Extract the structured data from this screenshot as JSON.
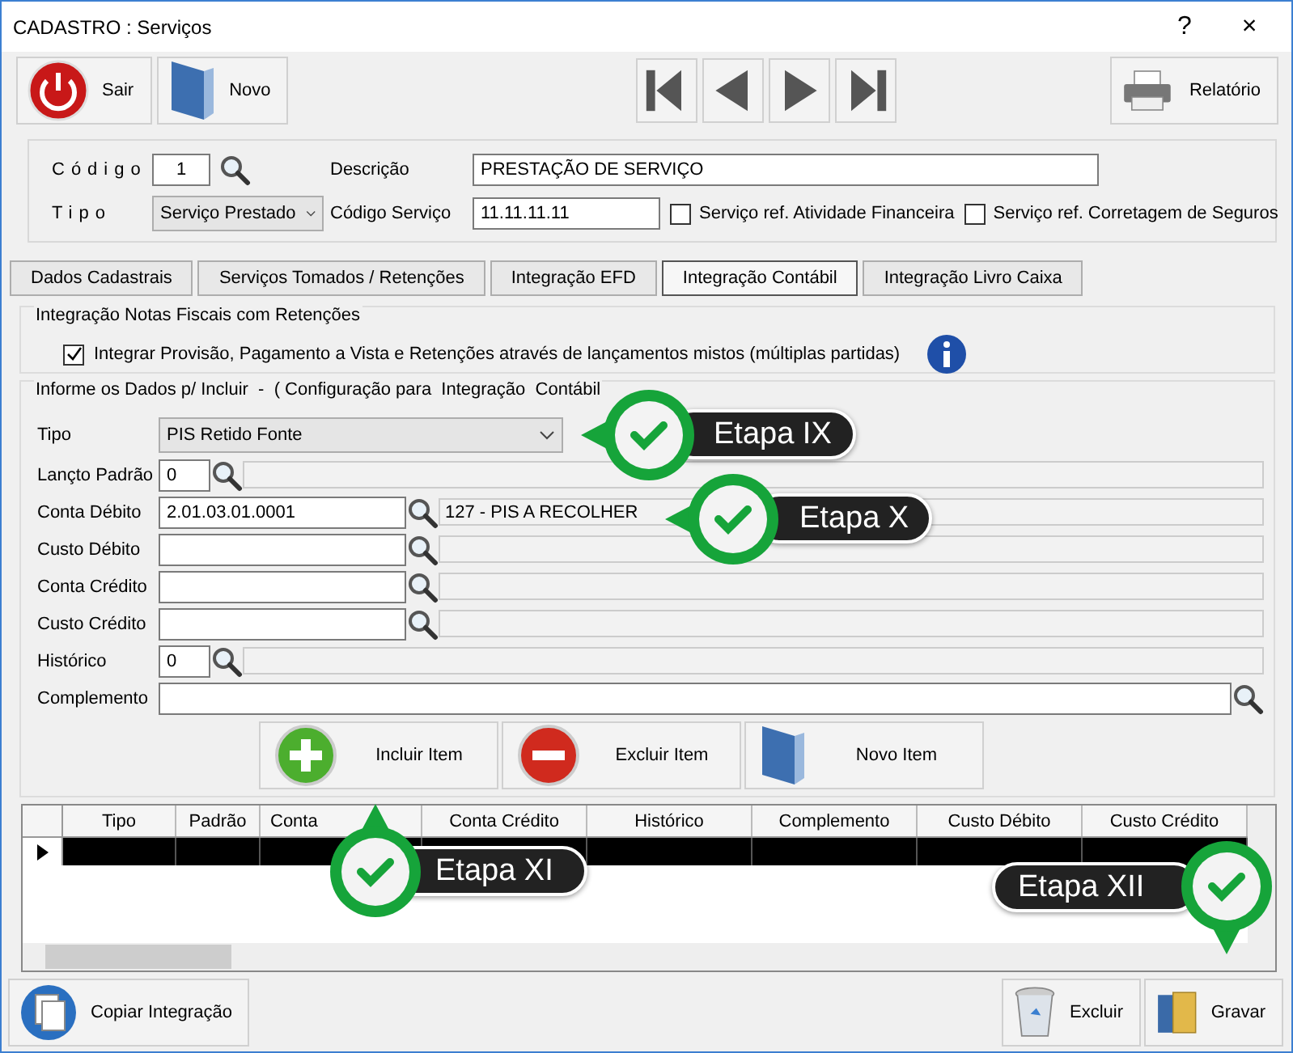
{
  "window": {
    "title": "CADASTRO : Serviços",
    "help": "?",
    "close": "×"
  },
  "toolbar": {
    "left": [
      {
        "label": "Sair",
        "kind": "power"
      },
      {
        "label": "Novo",
        "kind": "book"
      }
    ],
    "nav": [
      {
        "kind": "first"
      },
      {
        "kind": "prev"
      },
      {
        "kind": "next"
      },
      {
        "kind": "last"
      }
    ],
    "right": [
      {
        "label": "Relatório",
        "kind": "printer"
      }
    ]
  },
  "header": {
    "codigo_label": "Código",
    "codigo": "1",
    "descricao_label": "Descrição",
    "descricao": "PRESTAÇÃO DE SERVIÇO",
    "tipo_label": "Tipo",
    "tipo": "Serviço Prestado",
    "codigo_servico_label": "Código Serviço",
    "codigo_servico": "11.11.11.11",
    "checks": [
      {
        "label": "Serviço ref. Atividade Financeira",
        "checked": false
      },
      {
        "label": "Serviço ref. Corretagem de Seguros",
        "checked": false
      }
    ]
  },
  "tabs": [
    {
      "label": "Dados Cadastrais",
      "selected": false
    },
    {
      "label": "Serviços Tomados / Retenções",
      "selected": false
    },
    {
      "label": "Integração EFD",
      "selected": false
    },
    {
      "label": "Integração Contábil",
      "selected": true
    },
    {
      "label": "Integração Livro Caixa",
      "selected": false
    }
  ],
  "notas_group": {
    "title": "Integração Notas Fiscais com Retenções",
    "label": "Integrar Provisão, Pagamento a Vista e Retenções através de lançamentos mistos (múltiplas partidas)",
    "checked": true
  },
  "dados_group": {
    "title": "Informe os Dados p/ Incluir  -  ( Configuração para  Integração  Contábil",
    "rows": [
      {
        "label": "Tipo",
        "kind": "select",
        "value": "PIS Retido Fonte"
      },
      {
        "label": "Lançto Padrão",
        "kind": "short",
        "value": "0"
      },
      {
        "label": "Conta Débito",
        "kind": "long",
        "value": "2.01.03.01.0001",
        "description": "127 - PIS A RECOLHER"
      },
      {
        "label": "Custo Débito",
        "kind": "long"
      },
      {
        "label": "Conta Crédito",
        "kind": "long"
      },
      {
        "label": "Custo Crédito",
        "kind": "long"
      },
      {
        "label": "Histórico",
        "kind": "short",
        "value": "0"
      },
      {
        "label": "Complemento",
        "kind": "wide"
      }
    ],
    "actions": [
      {
        "label": "Incluir Item",
        "kind": "plus"
      },
      {
        "label": "Excluir Item",
        "kind": "minus"
      },
      {
        "label": "Novo Item",
        "kind": "book"
      }
    ]
  },
  "grid": {
    "columns": [
      "Tipo",
      "Padrão",
      "Conta",
      "Conta Crédito",
      "Histórico",
      "Complemento",
      "Custo Débito",
      "Custo Crédito"
    ],
    "rows": [
      {
        "selected": true
      }
    ]
  },
  "bottom": {
    "left": [
      {
        "label": "Copiar Integração",
        "kind": "copy"
      }
    ],
    "right": [
      {
        "label": "Excluir",
        "kind": "trash"
      },
      {
        "label": "Gravar",
        "kind": "folder"
      }
    ]
  },
  "callouts": [
    {
      "label": "Etapa IX"
    },
    {
      "label": "Etapa X"
    },
    {
      "label": "Etapa XI"
    },
    {
      "label": "Etapa XII"
    }
  ]
}
